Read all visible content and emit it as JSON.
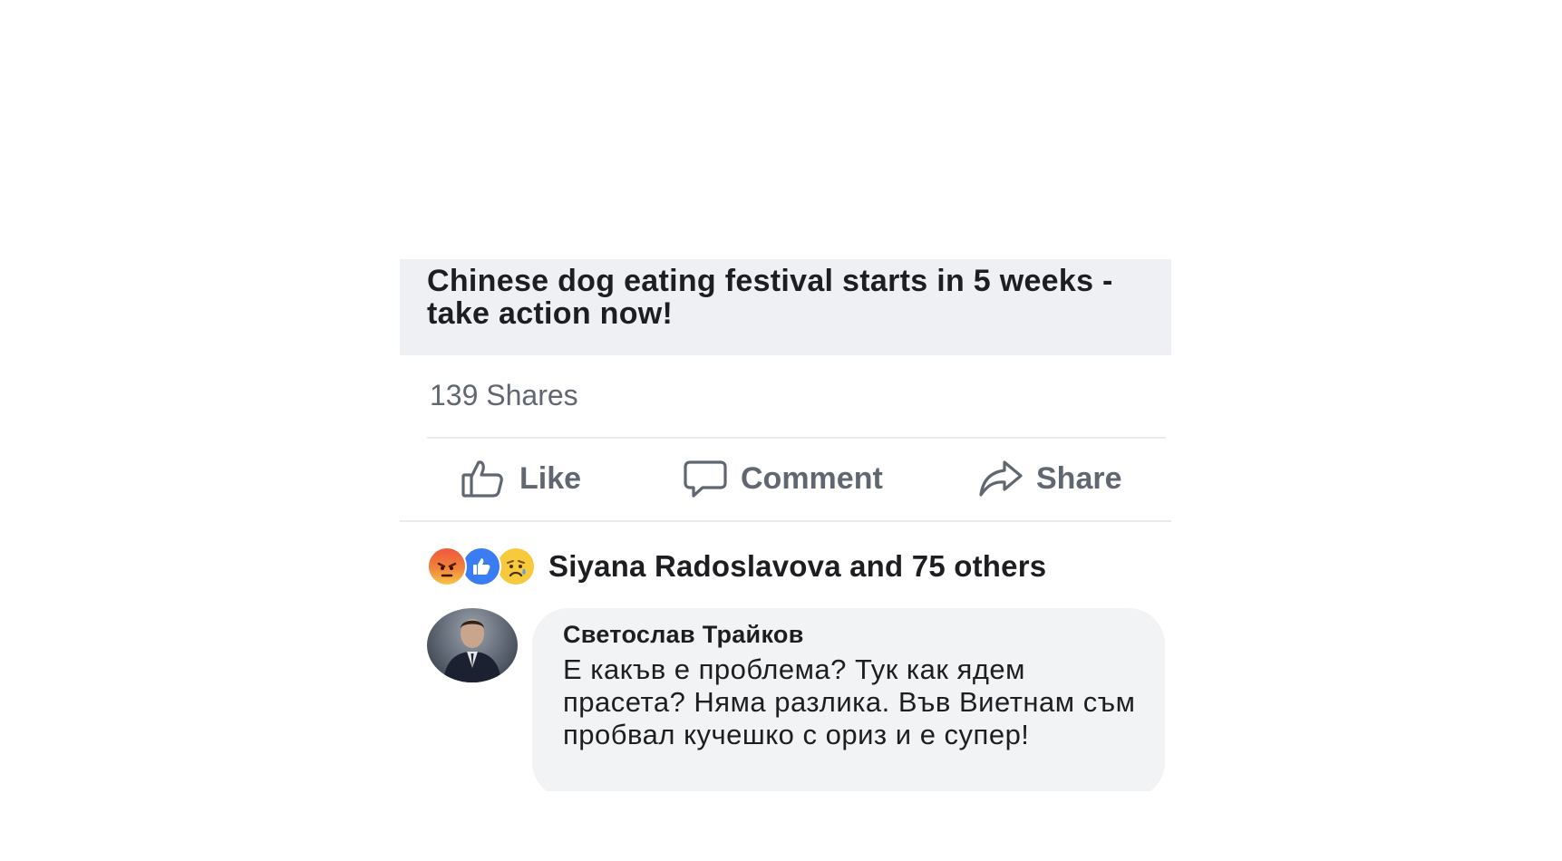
{
  "post": {
    "link_title": "Chinese dog eating festival starts in 5 weeks - take action now!",
    "shares": "139 Shares",
    "actions": {
      "like": "Like",
      "comment": "Comment",
      "share": "Share"
    },
    "reactions": {
      "icons": [
        "angry-reaction-icon",
        "like-reaction-icon",
        "sad-reaction-icon"
      ],
      "summary": "Siyana Radoslavova and 75 others"
    },
    "comment": {
      "author": "Светослав Трайков",
      "text": "Е какъв е проблема? Тук как ядем прасета? Няма разлика. Във Виетнам съм пробвал кучешко с ориз и е супер!"
    }
  },
  "colors": {
    "link_preview_bg": "#eef0f3",
    "action_text": "#606770",
    "like_blue": "#3a7cf2",
    "angry_red": "#f0573c",
    "sad_yellow": "#f7c93d",
    "comment_bubble_bg": "#f2f3f5"
  }
}
